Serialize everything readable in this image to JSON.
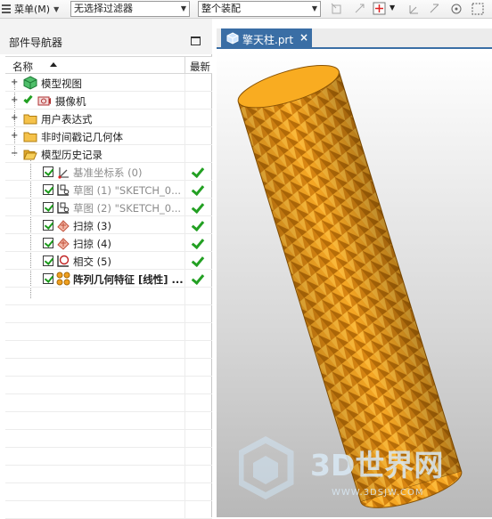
{
  "toolbar": {
    "menu_label": "菜单(M)",
    "filter_value": "无选择过滤器",
    "scope_value": "整个装配"
  },
  "navigator": {
    "title": "部件导航器",
    "col_name": "名称",
    "col_latest": "最新"
  },
  "tree": [
    {
      "label": "模型视图",
      "icon": "model-views-icon"
    },
    {
      "label": "摄像机",
      "icon": "camera-icon"
    },
    {
      "label": "用户表达式",
      "icon": "folder-icon"
    },
    {
      "label": "非时间戳记几何体",
      "icon": "folder-icon"
    },
    {
      "label": "模型历史记录",
      "icon": "folder-open-icon"
    },
    {
      "label": "基准坐标系 (0)",
      "icon": "datum-csys-icon",
      "latest": true
    },
    {
      "label": "草图 (1) \"SKETCH_0...",
      "icon": "sketch-icon",
      "latest": true
    },
    {
      "label": "草图 (2) \"SKETCH_0...",
      "icon": "sketch-icon",
      "latest": true
    },
    {
      "label": "扫掠 (3)",
      "icon": "swept-icon",
      "latest": true
    },
    {
      "label": "扫掠 (4)",
      "icon": "swept-icon",
      "latest": true
    },
    {
      "label": "相交 (5)",
      "icon": "intersect-icon",
      "latest": true
    },
    {
      "label": "阵列几何特征 [线性] ...",
      "icon": "pattern-geometry-icon",
      "latest": true
    }
  ],
  "graphics": {
    "tab_label": "擎天柱.prt",
    "close_glyph": "×"
  },
  "watermark": {
    "brand": "3D世界网",
    "url": "WWW.3DSJW.COM"
  },
  "colors": {
    "accent": "#3a6ea5",
    "part": "#f5a623",
    "part_dark": "#c77a0e",
    "check": "#23a023"
  }
}
